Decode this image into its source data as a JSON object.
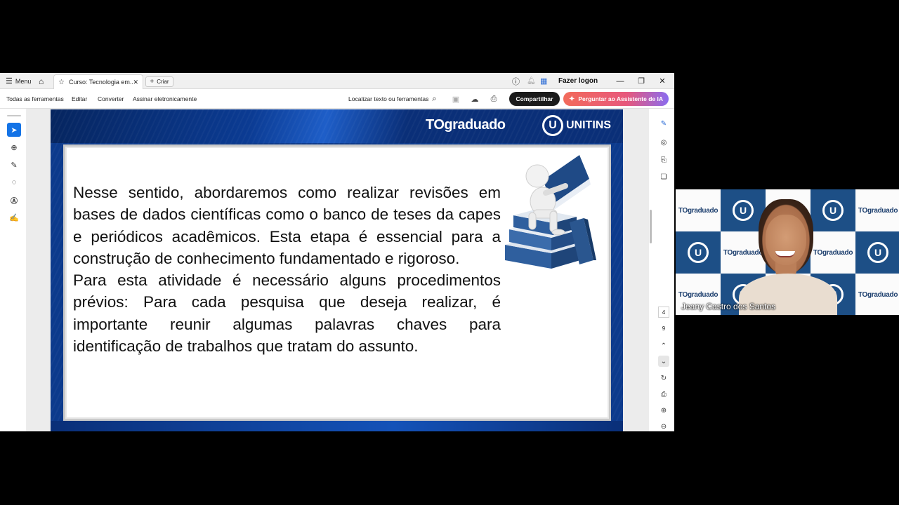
{
  "titlebar": {
    "menu_label": "Menu",
    "tab_title": "Curso: Tecnologia em...",
    "new_tab_label": "Criar",
    "logon_label": "Fazer logon"
  },
  "toolbar": {
    "all_tools": "Todas as ferramentas",
    "edit": "Editar",
    "convert": "Converter",
    "sign": "Assinar eletronicamente",
    "search_label": "Localizar texto ou ferramentas",
    "share_label": "Compartilhar",
    "ai_label": "Perguntar ao Assistente de IA"
  },
  "slide": {
    "brand_left": "TOgraduado",
    "brand_right": "UNITINS",
    "paragraph_1": "Nesse sentido, abordaremos como realizar revisões em bases de dados científicas como o banco de teses da capes e periódicos acadêmicos. Esta etapa é essencial para a construção de conhecimento fundamentado e rigoroso.",
    "paragraph_2": "Para esta atividade é necessário alguns procedimentos prévios: Para cada pesquisa que deseja realizar, é importante reunir algumas palavras chaves para identificação de trabalhos que tratam do assunto."
  },
  "navigation": {
    "current_page": "4",
    "total_pages": "9"
  },
  "webcam": {
    "participant_name": "Jeany Castro dos Santos",
    "backdrop_text": "TOgraduado",
    "backdrop_mark": "U"
  },
  "colors": {
    "accent_blue": "#1473e6",
    "slide_blue": "#0c3a8c",
    "share_bg": "#1b1b1b",
    "ai_gradient_start": "#f26b5b"
  }
}
